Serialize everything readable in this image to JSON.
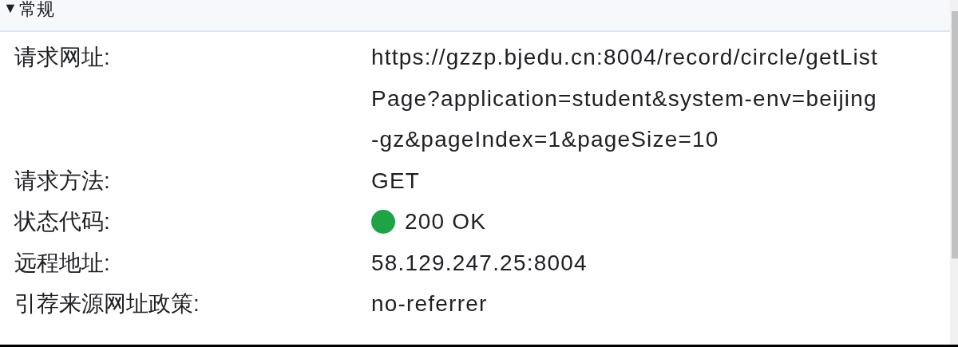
{
  "section": {
    "toggle": "▼",
    "title": "常规",
    "expanded": true
  },
  "rows": [
    {
      "label": "请求网址:",
      "value": "https://gzzp.bjedu.cn:8004/record/circle/getListPage?application=student&system-env=beijing-gz&pageIndex=1&pageSize=10"
    },
    {
      "label": "请求方法:",
      "value": "GET"
    },
    {
      "label": "状态代码:",
      "value": "200 OK",
      "color": "#1ea446"
    },
    {
      "label": "远程地址:",
      "value": "58.129.247.25:8004"
    },
    {
      "label": "引荐来源网址政策:",
      "value": "no-referrer"
    }
  ]
}
